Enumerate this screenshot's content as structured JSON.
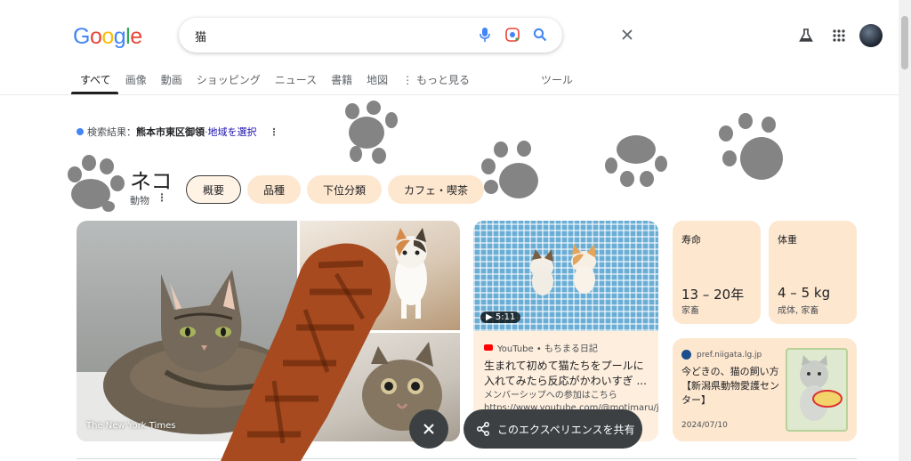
{
  "header": {
    "logo_letters": [
      "G",
      "o",
      "o",
      "g",
      "l",
      "e"
    ],
    "logo_colors": [
      "#4285F4",
      "#EA4335",
      "#FBBC05",
      "#4285F4",
      "#34A853",
      "#EA4335"
    ],
    "query": "猫",
    "icons": [
      "close-icon",
      "mic-icon",
      "lens-icon",
      "search-icon",
      "labs-icon",
      "apps-icon",
      "avatar"
    ]
  },
  "tabs": {
    "items": [
      "すべて",
      "画像",
      "動画",
      "ショッピング",
      "ニュース",
      "書籍",
      "地図"
    ],
    "more": "もっと見る",
    "tools": "ツール",
    "active": "すべて"
  },
  "location": {
    "prefix": "検索結果：",
    "place": "熊本市東区御領",
    "separator": " · ",
    "link": "地域を選択"
  },
  "entity": {
    "title": "ネコ",
    "subtitle": "動物"
  },
  "chips": [
    "概要",
    "品種",
    "下位分類",
    "カフェ・喫茶"
  ],
  "images": {
    "caption": "The New York Times"
  },
  "video": {
    "duration": "5:11",
    "source": "YouTube • もちまる日記",
    "title": "生まれて初めて猫たちをプールに入れてみたら反応がかわいすぎ ...",
    "desc": "メンバーシップへの参加はこちら",
    "url": "https://www.youtube.com/@motimaru/joi..."
  },
  "facts": [
    {
      "label": "寿命",
      "value": "13 – 20年",
      "note": "家畜"
    },
    {
      "label": "体重",
      "value": "4 – 5 kg",
      "note": "成体, 家畜"
    }
  ],
  "pref_card": {
    "source": "pref.niigata.lg.jp",
    "title": "今どきの、猫の飼い方【新潟県動物愛護センター】",
    "date": "2024/07/10"
  },
  "share": {
    "label": "このエクスペリエンスを共有"
  },
  "colors": {
    "chip_bg": "#fde7cf",
    "paw": "#6f6f6f",
    "brush": "#a84a1f"
  }
}
